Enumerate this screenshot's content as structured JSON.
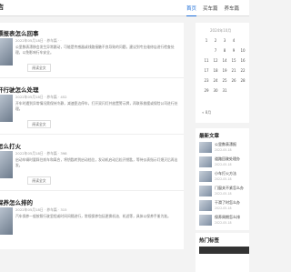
{
  "header": {
    "logo": "店",
    "nav": [
      "首页",
      "买车篇",
      "养车篇"
    ]
  },
  "articles": [
    {
      "title": "漂报表怎么回事",
      "meta": "2022年05月18日  ·  养车篇  ·  ·",
      "excerpt": "公里数表漂移会发生异常跳动，可能是传感器或线路接触不良导致的问题，建议到专业维修店进行检查处理，以免影响行车安全。",
      "more": "阅读全文"
    },
    {
      "title": "开行驶怎么处理",
      "meta": "2022年05月18日  ·  养车篇  ·  452",
      "excerpt": "开车时遇到异常情况需保持冷静，减速靠边停车，打开双闪灯并放置警示牌，再联系救援或保险公司进行处理。",
      "more": "阅读全文"
    },
    {
      "title": "怎么打火",
      "meta": "2022年05月18日  ·  养车篇  ·  398",
      "excerpt": "启动车辆时要踩住刹车和离合，将钥匙转到启动档位，发动机启动后松开钥匙，等待仪表指示灯熄灭后再出发。",
      "more": "阅读全文"
    },
    {
      "title": "保养怎么排的",
      "meta": "2022年05月18日  ·  养车篇  ·  315",
      "excerpt": "汽车保养一般按照行驶里程或时间间隔进行，常规保养包括更换机油、机滤等，具体以保养手册为准。",
      "more": "阅读全文"
    }
  ],
  "calendar": {
    "title": "2024年10月",
    "days": [
      "1",
      "2",
      "3",
      "4",
      "",
      "",
      "7",
      "8",
      "9",
      "10",
      "11",
      "12",
      "14",
      "15",
      "16",
      "17",
      "18",
      "19",
      "21",
      "22",
      "23",
      "24",
      "25",
      "26",
      "28",
      "29",
      "30",
      "31",
      "",
      ""
    ],
    "nav": "« 8月"
  },
  "latest": {
    "title": "最新文章",
    "items": [
      {
        "title": "公里数表漂报",
        "meta": "2022-05-18"
      },
      {
        "title": "道路回驶处理办",
        "meta": "2022-05-18"
      },
      {
        "title": "小车打火方法",
        "meta": "2022-05-18"
      },
      {
        "title": "门窗关不紧怎么办",
        "meta": "2022-05-18"
      },
      {
        "title": "干滑了时怎么办",
        "meta": "2022-05-18"
      },
      {
        "title": "保养周期怎么排",
        "meta": "2022-05-18"
      }
    ]
  },
  "hot": {
    "title": "热门标签"
  }
}
